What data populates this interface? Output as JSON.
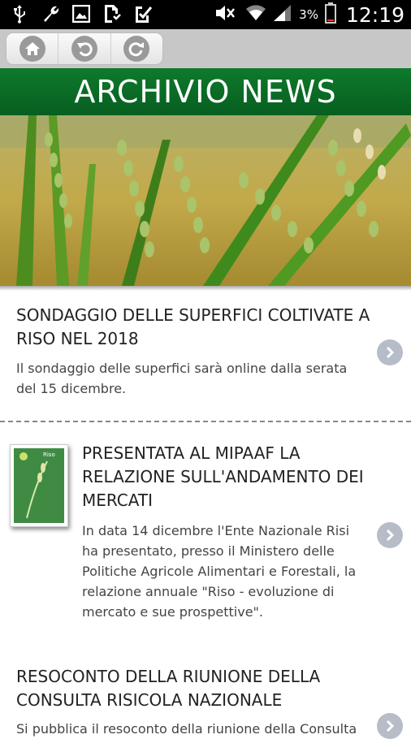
{
  "status_bar": {
    "battery_percent": "3%",
    "time": "12:19",
    "icons": [
      "usb-icon",
      "wrench-icon",
      "image-icon",
      "file-check-icon",
      "clipboard-check-icon",
      "mute-icon",
      "wifi-icon",
      "signal-icon",
      "battery-icon"
    ]
  },
  "toolbar": {
    "buttons": [
      "home-icon",
      "undo-icon",
      "refresh-icon"
    ]
  },
  "header": {
    "title": "ARCHIVIO NEWS"
  },
  "news": [
    {
      "title_lines": [
        "SONDAGGIO DELLE SUPERFICI COLTIVATE A",
        "RISO NEL 2018"
      ],
      "desc_lines": [
        "Il sondaggio delle superfici sarà online dalla serata",
        "del 15 dicembre."
      ]
    },
    {
      "title_lines": [
        "PRESENTATA AL MIPAAF LA",
        "RELAZIONE SULL'ANDAMENTO DEI",
        "MERCATI"
      ],
      "desc_lines": [
        "In data 14 dicembre l'Ente Nazionale Risi",
        "ha presentato, presso il Ministero delle",
        "Politiche Agricole Alimentari e Forestali, la",
        "relazione annuale \"Riso - evoluzione di",
        "mercato e sue prospettive\"."
      ],
      "thumb_label": "Riso"
    },
    {
      "title_lines": [
        "RESOCONTO DELLA RIUNIONE DELLA",
        "CONSULTA RISICOLA NAZIONALE"
      ],
      "desc_lines": [
        "Si pubblica il resoconto della riunione della Consulta"
      ]
    }
  ],
  "colors": {
    "header_green": "#0b6d26",
    "chevron": "#b6bcc8"
  }
}
